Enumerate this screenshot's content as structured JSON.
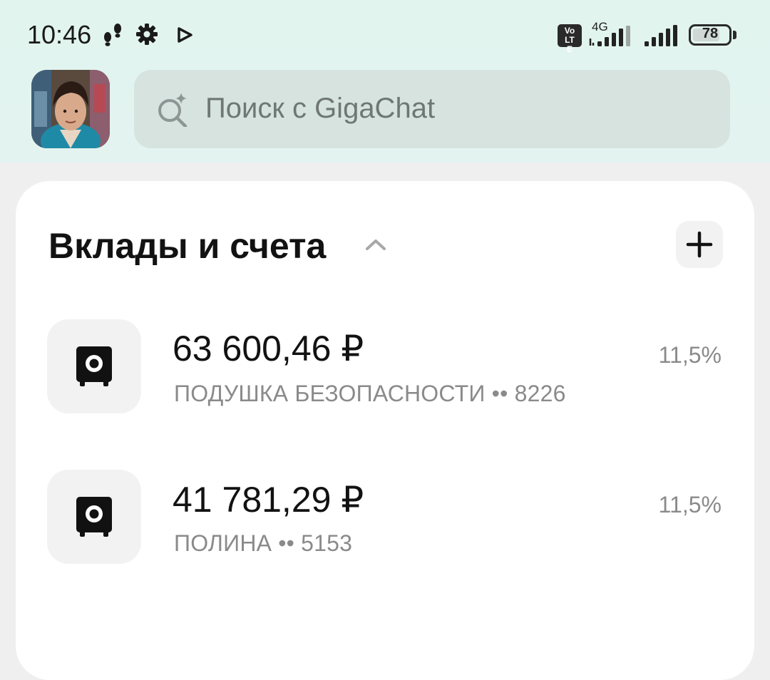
{
  "status_bar": {
    "time": "10:46",
    "volte_label": "Vo LTE",
    "network_label": "4G",
    "battery_level": "78",
    "battery_fraction": 0.78,
    "icons": [
      "footsteps-icon",
      "gear-icon",
      "play-icon",
      "volte-icon",
      "signal-4g-icon",
      "signal-icon",
      "battery-icon"
    ]
  },
  "header": {
    "avatar": "avatar",
    "search_placeholder": "Поиск с GigaChat",
    "search_icon": "sparkle-search-icon"
  },
  "section": {
    "title": "Вклады и счета",
    "collapse_icon": "chevron-up-icon",
    "add_icon": "plus-icon"
  },
  "accounts": [
    {
      "amount": "63 600,46 ₽",
      "name": "ПОДУШКА БЕЗОПАСНОСТИ •• 8226",
      "rate": "11,5%",
      "icon": "safe-icon"
    },
    {
      "amount": "41 781,29 ₽",
      "name": "ПОЛИНА •• 5153",
      "rate": "11,5%",
      "icon": "safe-icon"
    }
  ],
  "colors": {
    "header_bg": "#e2f4ee",
    "search_bg": "#d6e3df",
    "card_bg": "#ffffff",
    "page_bg": "#efefef",
    "text_primary": "#121212",
    "text_secondary": "#8a8a8a"
  }
}
